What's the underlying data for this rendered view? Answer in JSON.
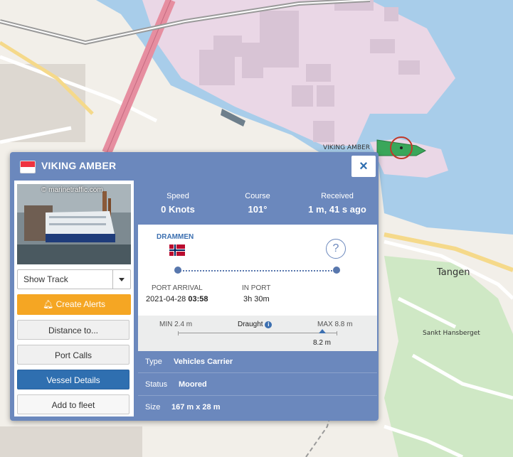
{
  "map": {
    "labels": {
      "vessel_label": "VIKING AMBER",
      "area_tangen": "Tangen",
      "area_sankt": "Sankt Hansberget"
    }
  },
  "popup": {
    "vessel_name": "VIKING AMBER",
    "close_icon": "×",
    "photo_credit": "© marinetraffic.com",
    "buttons": {
      "show_track": "Show Track",
      "create_alerts": "Create Alerts",
      "distance_to": "Distance to...",
      "port_calls": "Port Calls",
      "vessel_details": "Vessel Details",
      "add_to_fleet": "Add to fleet"
    },
    "stats": {
      "speed_label": "Speed",
      "speed_value": "0 Knots",
      "course_label": "Course",
      "course_value": "101°",
      "received_label": "Received",
      "received_value": "1 m, 41 s ago"
    },
    "voyage": {
      "destination": "DRAMMEN",
      "unknown_icon": "?",
      "port_arrival_label": "PORT ARRIVAL",
      "port_arrival_date": "2021-04-28",
      "port_arrival_time": "03:58",
      "in_port_label": "IN PORT",
      "in_port_value": "3h 30m"
    },
    "draught": {
      "min_label": "MIN 2.4 m",
      "label": "Draught",
      "max_label": "MAX 8.8 m",
      "value": "8.2 m",
      "min": 2.4,
      "max": 8.8,
      "current": 8.2
    },
    "details": {
      "type_label": "Type",
      "type_value": "Vehicles Carrier",
      "status_label": "Status",
      "status_value": "Moored",
      "size_label": "Size",
      "size_value": "167 m x 28 m"
    }
  },
  "colors": {
    "popup_bg": "#6b88bd",
    "alerts_orange": "#f5a623",
    "details_blue": "#2f6fb0",
    "water": "#a8cdea",
    "vessel_green": "#3aa65a"
  }
}
